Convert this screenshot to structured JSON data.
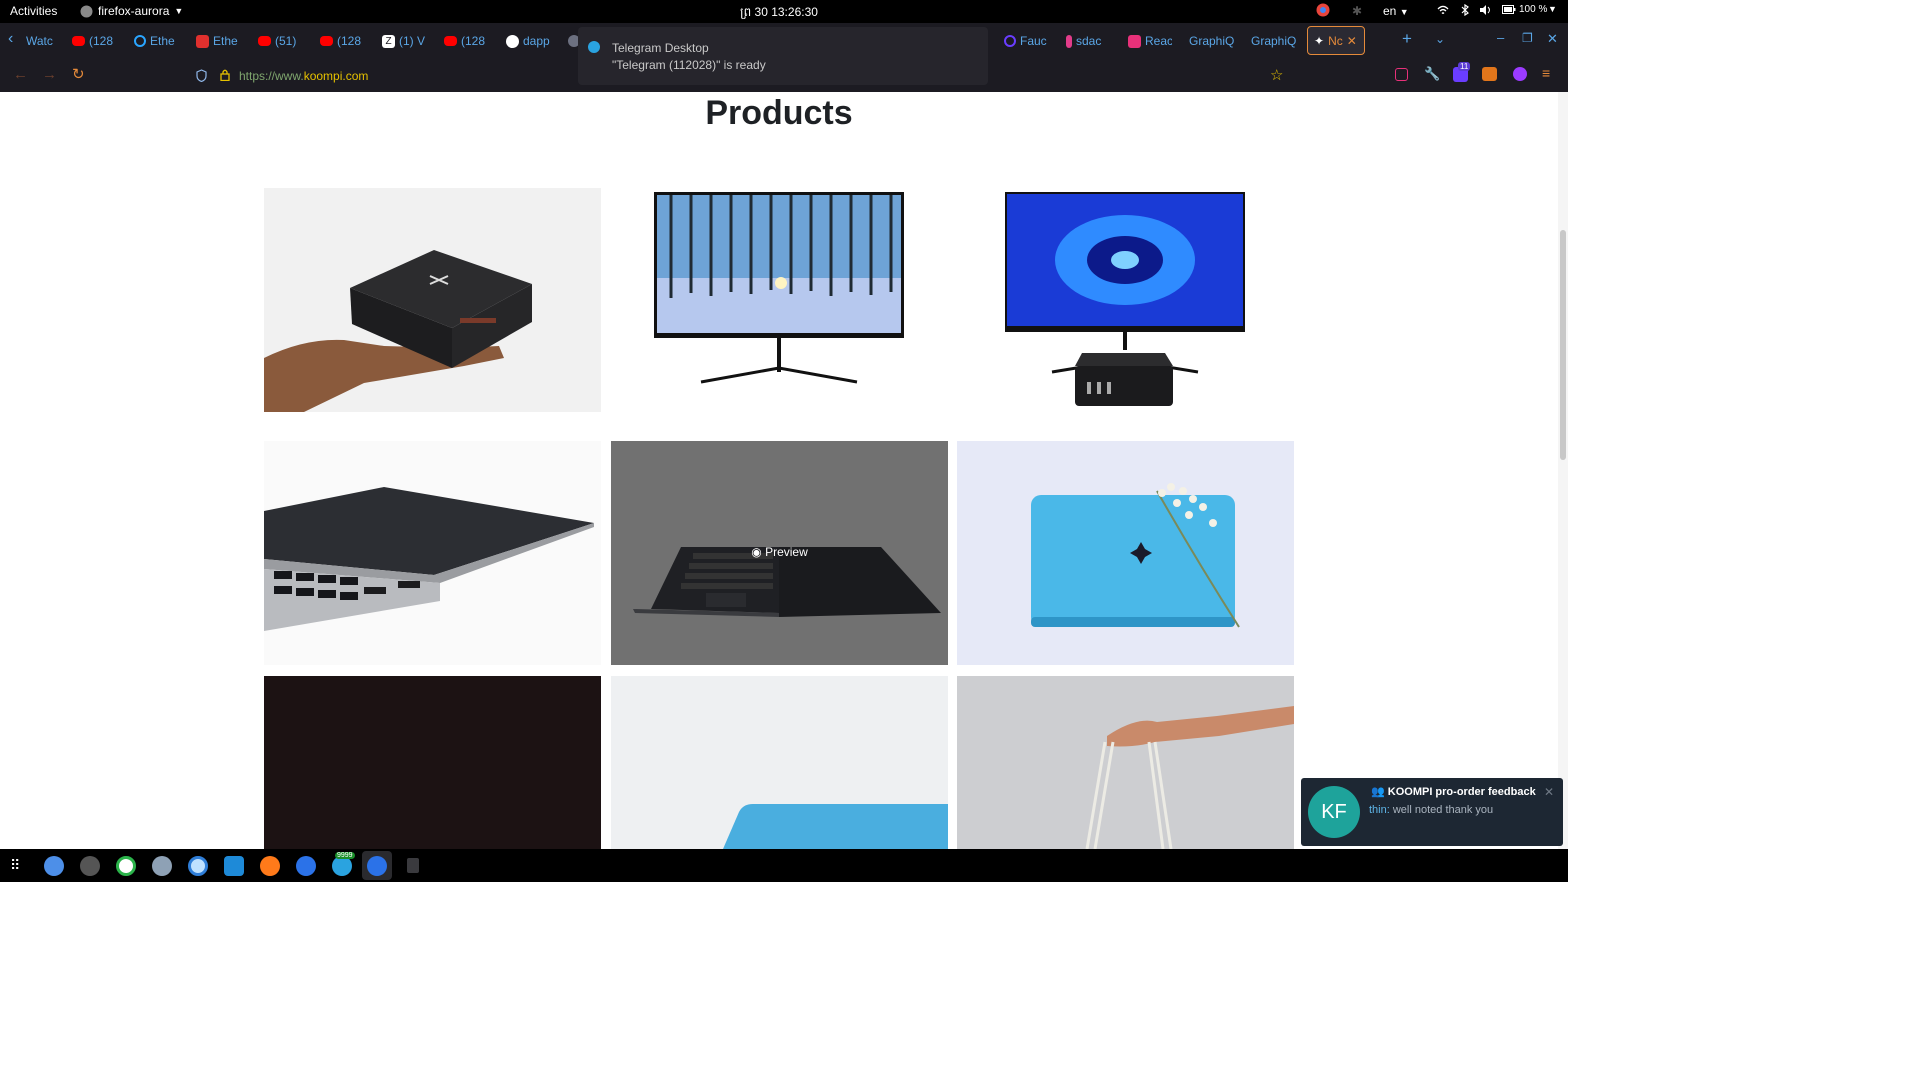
{
  "topbar": {
    "activities": "Activities",
    "app_menu": "firefox-aurora",
    "clock": "ព្រ 30  13:26:30",
    "lang": "en",
    "battery": "100 %"
  },
  "tabs": [
    {
      "label": "Watc",
      "color": "#1c1b22"
    },
    {
      "label": "(128",
      "color": "#ff0000"
    },
    {
      "label": "Ethe",
      "color": "#2aa5ff"
    },
    {
      "label": "Ethe",
      "color": "#e0302e"
    },
    {
      "label": "(51)",
      "color": "#ff0000"
    },
    {
      "label": "(128",
      "color": "#ff0000"
    },
    {
      "label": "(1) V",
      "color": "#ffffff"
    },
    {
      "label": "(128",
      "color": "#ff0000"
    },
    {
      "label": "dapp",
      "color": "#ffffff"
    },
    {
      "label": "Fauc",
      "color": "#6a3dff"
    },
    {
      "label": "sdac",
      "color": "#e23c8a"
    },
    {
      "label": "Reac",
      "color": "#e8317a"
    },
    {
      "label": "GraphiQ",
      "color": ""
    },
    {
      "label": "GraphiQ",
      "color": ""
    },
    {
      "label": "Nc",
      "color": "#ffffff"
    }
  ],
  "nav": {
    "url_prefix": "https://www.",
    "url_domain": "koompi.com"
  },
  "telegram_notification": {
    "title": "Telegram Desktop",
    "body": "\"Telegram (112028)\" is ready"
  },
  "page": {
    "heading": "Products",
    "preview_label": "Preview"
  },
  "toast": {
    "avatar": "KF",
    "title": "KOOMPI pro-order feedback",
    "sender": "thin:",
    "message": "well noted thank you"
  },
  "extensions": {
    "badge_count": "11"
  },
  "dock": {
    "telegram_badge": "9999"
  }
}
